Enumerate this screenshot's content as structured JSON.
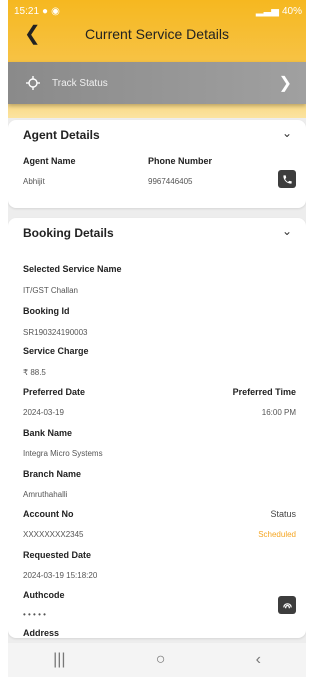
{
  "status_bar": {
    "time": "15:21",
    "battery": "40%"
  },
  "header": {
    "title": "Current Service Details"
  },
  "track": {
    "label": "Track Status"
  },
  "agent": {
    "heading": "Agent Details",
    "name_label": "Agent Name",
    "name_value": "Abhijit",
    "phone_label": "Phone Number",
    "phone_value": "9967446405"
  },
  "booking": {
    "heading": "Booking Details",
    "service_label": "Selected Service Name",
    "service_value": "IT/GST Challan",
    "booking_id_label": "Booking Id",
    "booking_id_value": "SR190324190003",
    "charge_label": "Service Charge",
    "charge_value": "₹ 88.5",
    "pref_date_label": "Preferred  Date",
    "pref_date_value": "2024-03-19",
    "pref_time_label": "Preferred Time",
    "pref_time_value": "16:00 PM",
    "bank_label": "Bank Name",
    "bank_value": "Integra Micro Systems",
    "branch_label": "Branch Name",
    "branch_value": "Amruthahalli",
    "account_label": "Account No",
    "account_value": "XXXXXXXX2345",
    "status_label": "Status",
    "status_value": "Scheduled",
    "req_date_label": "Requested Date",
    "req_date_value": "2024-03-19 15:18:20",
    "authcode_label": "Authcode",
    "authcode_value": "• • • • •",
    "address_label": "Address"
  },
  "colors": {
    "header": "#f6b820",
    "status": "#f5a623",
    "track": "#8a8a8a"
  },
  "icons": [
    "back-arrow-icon",
    "location-icon",
    "chevron-right-icon",
    "chevron-down-icon",
    "phone-icon",
    "fingerprint-icon",
    "recents-icon",
    "home-icon",
    "back-icon"
  ]
}
